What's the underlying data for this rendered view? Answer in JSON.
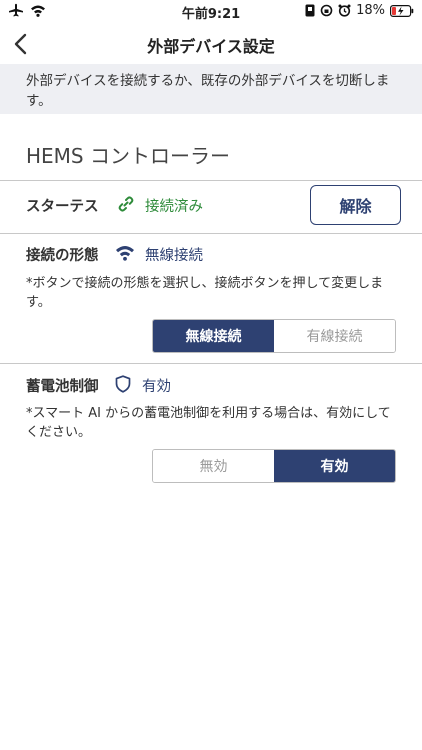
{
  "status_bar": {
    "time": "午前9:21",
    "battery": "18%"
  },
  "nav": {
    "title": "外部デバイス設定"
  },
  "notice": "外部デバイスを接続するか、既存の外部デバイスを切断します。",
  "device": {
    "name": "HEMS コントローラー"
  },
  "status": {
    "label": "スターテス",
    "value": "接続済み",
    "unlink_label": "解除"
  },
  "connection": {
    "label": "接続の形態",
    "value": "無線接続",
    "help": "*ボタンで接続の形態を選択し、接続ボタンを押して変更します。",
    "options": [
      "無線接続",
      "有線接続"
    ],
    "selected": "無線接続"
  },
  "battery_control": {
    "label": "蓄電池制御",
    "value": "有効",
    "help": "*スマート AI からの蓄電池制御を利用する場合は、有効にしてください。",
    "options": [
      "無効",
      "有効"
    ],
    "selected": "有効"
  },
  "colors": {
    "accent": "#2e4172",
    "connected_green": "#2e8b3a",
    "notice_bg": "#eeeff3"
  }
}
